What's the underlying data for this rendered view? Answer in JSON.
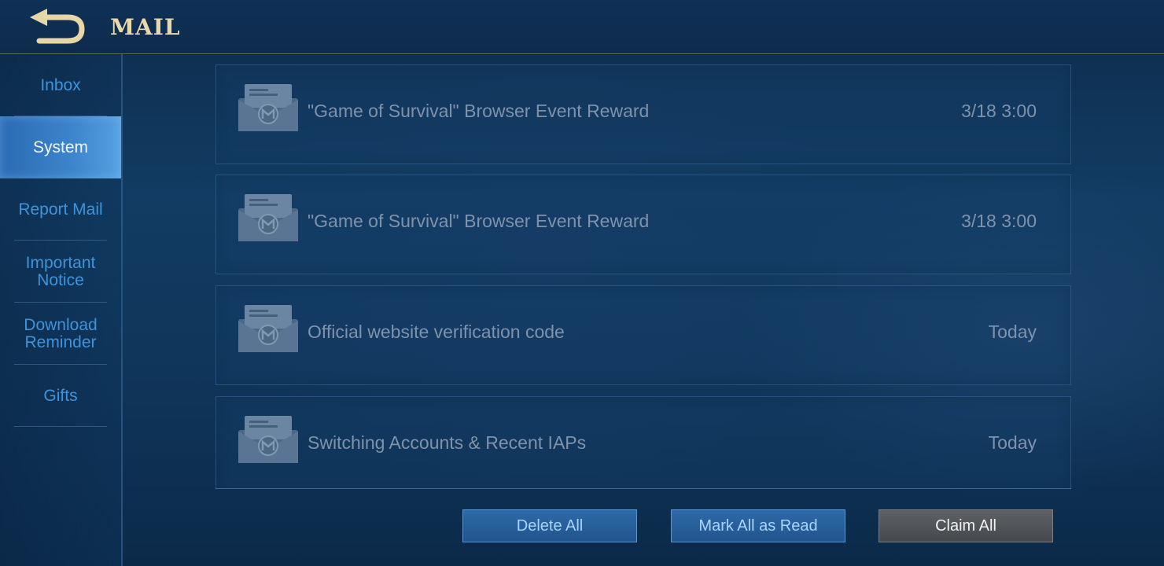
{
  "header": {
    "title": "MAIL",
    "back_icon": "back-arrow-icon"
  },
  "sidebar": {
    "items": [
      {
        "label": "Inbox",
        "active": false
      },
      {
        "label": "System",
        "active": true
      },
      {
        "label": "Report Mail",
        "active": false
      },
      {
        "label": "Important Notice",
        "active": false
      },
      {
        "label": "Download Reminder",
        "active": false
      },
      {
        "label": "Gifts",
        "active": false
      }
    ]
  },
  "mails": [
    {
      "subject": "\"Game of Survival\" Browser Event Reward",
      "date": "3/18 3:00",
      "icon": "mail-envelope-icon"
    },
    {
      "subject": "\"Game of Survival\" Browser Event Reward",
      "date": "3/18 3:00",
      "icon": "mail-envelope-icon"
    },
    {
      "subject": "Official website verification code",
      "date": "Today",
      "icon": "mail-envelope-icon"
    },
    {
      "subject": "Switching Accounts & Recent IAPs",
      "date": "Today",
      "icon": "mail-envelope-icon"
    }
  ],
  "actions": {
    "delete_all": "Delete All",
    "mark_all_read": "Mark All as Read",
    "claim_all": "Claim All"
  },
  "colors": {
    "title_gold": "#e9d8ab",
    "sidebar_text": "#3e93dd",
    "sidebar_active_bg": "#3d85cc",
    "mail_text": "#7f92a9",
    "button_blue": "#21558d",
    "button_gray": "#45484d"
  }
}
